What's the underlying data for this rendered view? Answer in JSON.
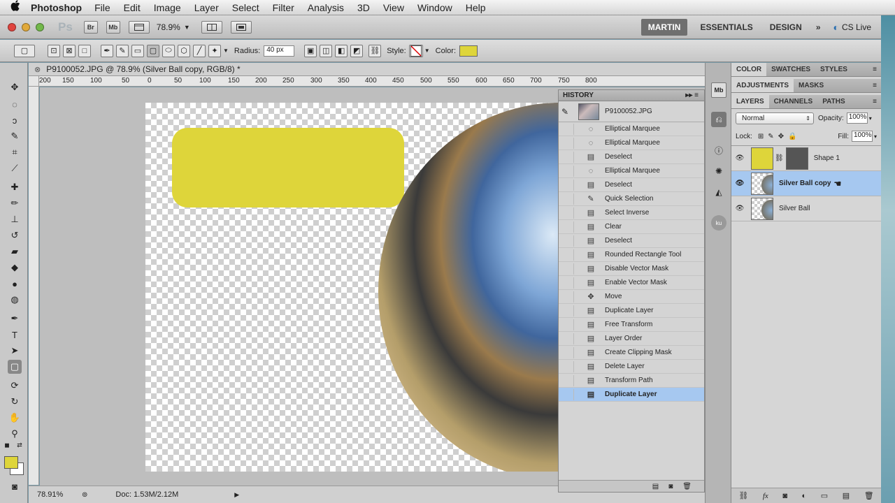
{
  "menubar": {
    "apple": "",
    "app_name": "Photoshop",
    "menus": [
      "File",
      "Edit",
      "Image",
      "Layer",
      "Select",
      "Filter",
      "Analysis",
      "3D",
      "View",
      "Window",
      "Help"
    ]
  },
  "appbar": {
    "logo": "Ps",
    "bridge": "Br",
    "minibridge": "Mb",
    "zoom": "78.9%",
    "workspaces": [
      "MARTIN",
      "ESSENTIALS",
      "DESIGN"
    ],
    "more": "»",
    "cs_live": "CS Live"
  },
  "options": {
    "radius_label": "Radius:",
    "radius_value": "40 px",
    "style_label": "Style:",
    "color_label": "Color:",
    "color_value": "#ded53a"
  },
  "document": {
    "tab_title": "P9100052.JPG @ 78.9% (Silver Ball copy, RGB/8) *",
    "ruler_ticks": [
      "200",
      "150",
      "100",
      "50",
      "0",
      "50",
      "100",
      "150",
      "200",
      "250",
      "300",
      "350",
      "400",
      "450",
      "500",
      "550",
      "600",
      "650",
      "700",
      "750",
      "800"
    ]
  },
  "status": {
    "zoom": "78.91%",
    "doc": "Doc: 1.53M/2.12M"
  },
  "history": {
    "title": "HISTORY",
    "snapshot": "P9100052.JPG",
    "items": [
      {
        "label": "Elliptical Marquee",
        "icon": "◌"
      },
      {
        "label": "Elliptical Marquee",
        "icon": "◌"
      },
      {
        "label": "Deselect",
        "icon": "▤"
      },
      {
        "label": "Elliptical Marquee",
        "icon": "◌"
      },
      {
        "label": "Deselect",
        "icon": "▤"
      },
      {
        "label": "Quick Selection",
        "icon": "✎"
      },
      {
        "label": "Select Inverse",
        "icon": "▤"
      },
      {
        "label": "Clear",
        "icon": "▤"
      },
      {
        "label": "Deselect",
        "icon": "▤"
      },
      {
        "label": "Rounded Rectangle Tool",
        "icon": "▤"
      },
      {
        "label": "Disable Vector Mask",
        "icon": "▤"
      },
      {
        "label": "Enable Vector Mask",
        "icon": "▤"
      },
      {
        "label": "Move",
        "icon": "✥"
      },
      {
        "label": "Duplicate Layer",
        "icon": "▤"
      },
      {
        "label": "Free Transform",
        "icon": "▤"
      },
      {
        "label": "Layer Order",
        "icon": "▤"
      },
      {
        "label": "Create Clipping Mask",
        "icon": "▤"
      },
      {
        "label": "Delete Layer",
        "icon": "▤"
      },
      {
        "label": "Transform Path",
        "icon": "▤"
      },
      {
        "label": "Duplicate Layer",
        "icon": "▤"
      }
    ]
  },
  "panels": {
    "group1_tabs": [
      "COLOR",
      "SWATCHES",
      "STYLES"
    ],
    "group2_tabs": [
      "ADJUSTMENTS",
      "MASKS"
    ],
    "group3_tabs": [
      "LAYERS",
      "CHANNELS",
      "PATHS"
    ],
    "blend_mode": "Normal",
    "opacity_label": "Opacity:",
    "opacity_value": "100%",
    "lock_label": "Lock:",
    "fill_label": "Fill:",
    "fill_value": "100%",
    "layers": [
      {
        "name": "Shape 1",
        "selected": false
      },
      {
        "name": "Silver Ball copy",
        "selected": true
      },
      {
        "name": "Silver Ball",
        "selected": false
      }
    ]
  }
}
